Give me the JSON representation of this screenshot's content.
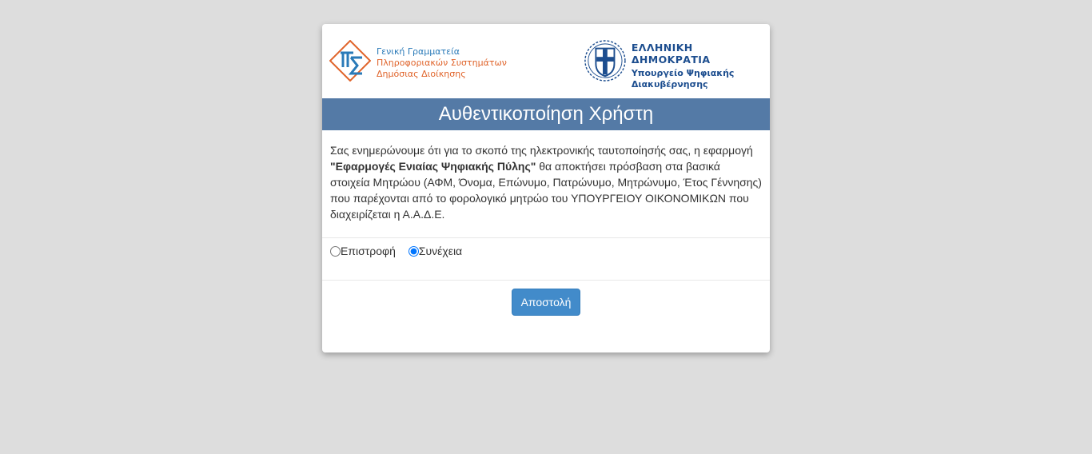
{
  "logos": {
    "gsis": {
      "line1": "Γενική Γραμματεία",
      "line2": "Πληροφοριακών Συστημάτων",
      "line3": "Δημόσιας Διοίκησης"
    },
    "gov": {
      "line1": "ΕΛΛΗΝΙΚΗ ΔΗΜΟΚΡΑΤΙΑ",
      "line2": "Υπουργείο Ψηφιακής",
      "line3": "Διακυβέρνησης"
    }
  },
  "title": "Αυθεντικοποίηση Χρήστη",
  "info": {
    "part1": "Σας ενημερώνουμε ότι για το σκοπό της ηλεκτρονικής ταυτοποίησής σας, η εφαρμογή ",
    "app_name": "\"Εφαρμογές Ενιαίας Ψηφιακής Πύλης\"",
    "part2": " θα αποκτήσει πρόσβαση στα βασικά στοιχεία Μητρώου (ΑΦΜ, Όνομα, Επώνυμο, Πατρώνυμο, Μητρώνυμο, Έτος Γέννησης) που παρέχονται από το φορολογικό μητρώο του ΥΠΟΥΡΓΕΙΟΥ ΟΙΚΟΝΟΜΙΚΩΝ που διαχειρίζεται η Α.Α.Δ.Ε."
  },
  "options": [
    {
      "label": "Επιστροφή",
      "checked": false
    },
    {
      "label": "Συνέχεια",
      "checked": true
    }
  ],
  "submit_label": "Αποστολή",
  "colors": {
    "title_bar": "#547aa6",
    "button": "#428bca",
    "background": "#dddddd"
  }
}
